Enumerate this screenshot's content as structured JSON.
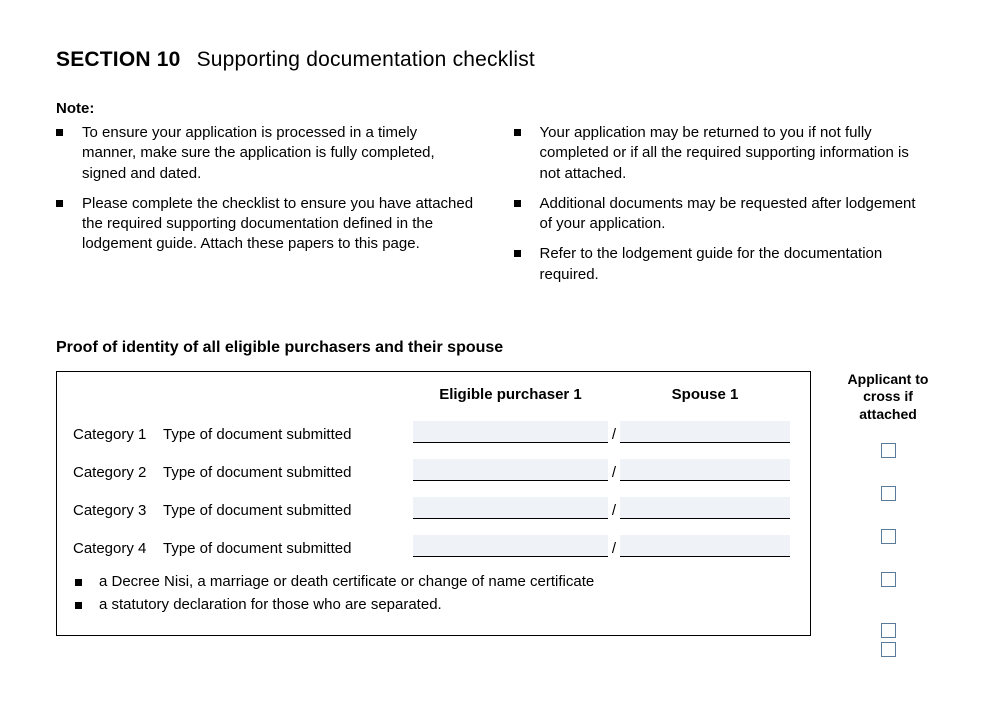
{
  "section": {
    "number": "SECTION 10",
    "title": "Supporting documentation checklist"
  },
  "note": {
    "label": "Note:",
    "left": [
      "To ensure your application is processed in a timely manner, make sure the application is fully completed, signed and dated.",
      "Please complete the checklist to ensure you have attached the required supporting documentation defined in the lodgement guide. Attach these papers to this page."
    ],
    "right": [
      "Your application may be returned to you if not fully completed or if all the required supporting information is not attached.",
      "Additional documents may be requested after lodgement of your application.",
      "Refer to the lodgement guide for the documentation required."
    ]
  },
  "subheading": "Proof of identity of all eligible purchasers and their spouse",
  "table": {
    "headers": {
      "col1": "Eligible purchaser 1",
      "col2": "Spouse 1"
    },
    "rows": [
      {
        "category": "Category 1",
        "label": "Type of document submitted",
        "slash": "/"
      },
      {
        "category": "Category 2",
        "label": "Type of document submitted",
        "slash": "/"
      },
      {
        "category": "Category 3",
        "label": "Type of document submitted",
        "slash": "/"
      },
      {
        "category": "Category 4",
        "label": "Type of document submitted",
        "slash": "/"
      }
    ],
    "extras": [
      "a Decree Nisi, a marriage or death certificate or change of name certificate",
      "a statutory declaration for those who are separated."
    ]
  },
  "checkColumn": {
    "header": "Applicant to cross if attached"
  }
}
